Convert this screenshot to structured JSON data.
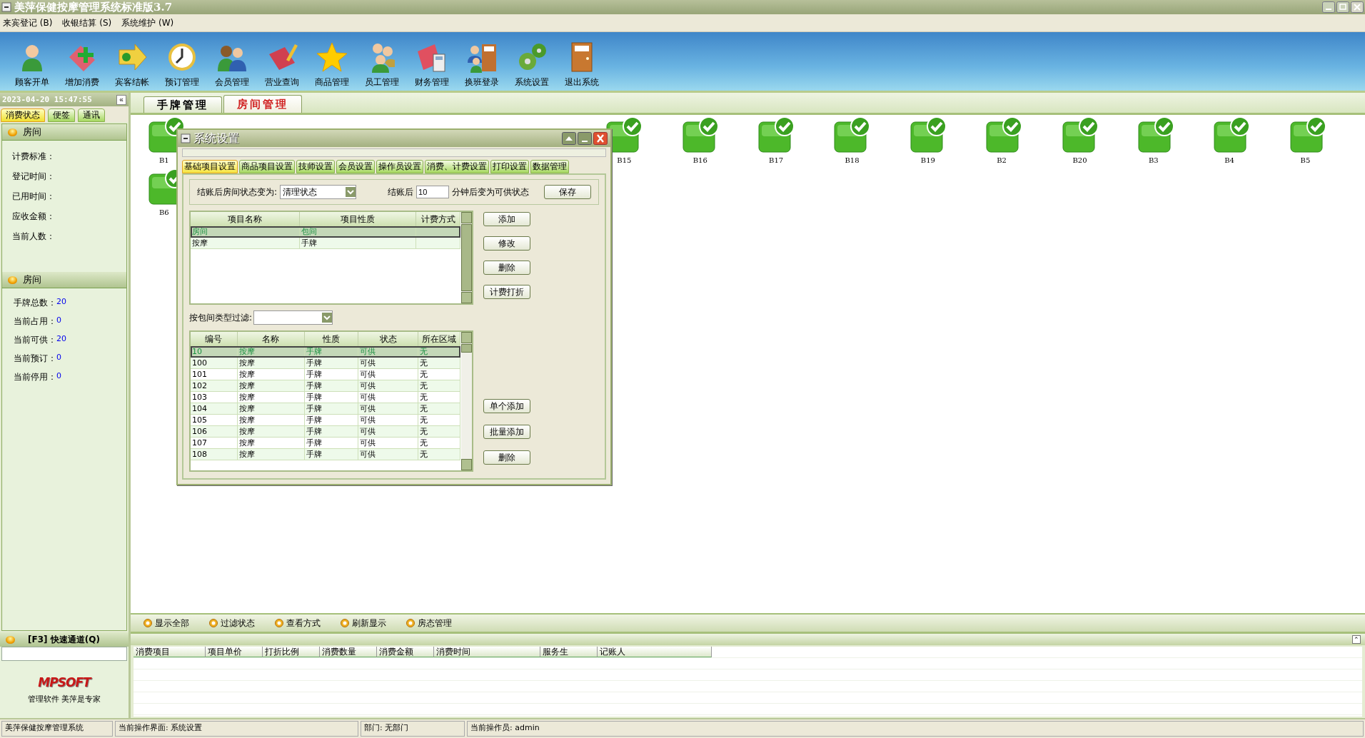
{
  "window": {
    "title": "美萍保健按摩管理系统标准版3.7"
  },
  "menu": [
    {
      "label": "来宾登记 (B)"
    },
    {
      "label": "收银结算 (S)"
    },
    {
      "label": "系统维护 (W)"
    }
  ],
  "toolbar": [
    {
      "label": "顾客开单"
    },
    {
      "label": "增加消费"
    },
    {
      "label": "宾客结帐"
    },
    {
      "label": "预订管理"
    },
    {
      "label": "会员管理"
    },
    {
      "label": "营业查询"
    },
    {
      "label": "商品管理"
    },
    {
      "label": "员工管理"
    },
    {
      "label": "财务管理"
    },
    {
      "label": "换班登录"
    },
    {
      "label": "系统设置"
    },
    {
      "label": "退出系统"
    }
  ],
  "clock": "2023-04-20 15:47:55",
  "collapse_button": "«",
  "left_tabs": [
    {
      "label": "消费状态",
      "selected": true
    },
    {
      "label": "便签",
      "selected": false
    },
    {
      "label": "通讯",
      "selected": false
    }
  ],
  "room_info": {
    "title": "房间",
    "fields": [
      {
        "label": "计费标准："
      },
      {
        "label": "登记时间："
      },
      {
        "label": "已用时间："
      },
      {
        "label": "应收金额："
      },
      {
        "label": "当前人数："
      }
    ]
  },
  "room_stats": {
    "title": "房间",
    "fields": [
      {
        "label": "手牌总数：",
        "value": "20"
      },
      {
        "label": "当前占用：",
        "value": "0"
      },
      {
        "label": "当前可供：",
        "value": "20"
      },
      {
        "label": "当前预订：",
        "value": "0"
      },
      {
        "label": "当前停用：",
        "value": "0"
      }
    ]
  },
  "quick": {
    "title": "[F3] 快速通道(Q)"
  },
  "brand": {
    "logo": "MPSOFT",
    "slogan": "管理软件 美萍是专家"
  },
  "main_tabs": [
    {
      "label": "手牌管理",
      "selected": false
    },
    {
      "label": "房间管理",
      "selected": true
    }
  ],
  "room_rows": [
    {
      "rooms": [
        {
          "name": "B1"
        },
        {
          "name": "B15"
        },
        {
          "name": "B16"
        },
        {
          "name": "B17"
        },
        {
          "name": "B18"
        },
        {
          "name": "B19"
        },
        {
          "name": "B2"
        },
        {
          "name": "B20"
        },
        {
          "name": "B3"
        },
        {
          "name": "B4"
        },
        {
          "name": "B5"
        }
      ]
    },
    {
      "rooms": [
        {
          "name": "B6"
        }
      ]
    }
  ],
  "actions": [
    {
      "label": "显示全部"
    },
    {
      "label": "过滤状态"
    },
    {
      "label": "查看方式"
    },
    {
      "label": "刷新显示"
    },
    {
      "label": "房态管理"
    }
  ],
  "log_table": {
    "expand_button": "⌃",
    "columns": [
      "消费项目",
      "项目单价",
      "打折比例",
      "消费数量",
      "消费金额",
      "消费时间",
      "服务生",
      "记账人"
    ]
  },
  "status_bar": [
    "美萍保健按摩管理系统",
    "当前操作界面: 系统设置",
    "部门: 无部门",
    "当前操作员: admin"
  ],
  "dialog": {
    "title": "系统设置",
    "tabs": [
      {
        "label": "基础项目设置",
        "selected": true
      },
      {
        "label": "商品项目设置",
        "selected": false
      },
      {
        "label": "技师设置",
        "selected": false
      },
      {
        "label": "会员设置",
        "selected": false
      },
      {
        "label": "操作员设置",
        "selected": false
      },
      {
        "label": "消费、计费设置",
        "selected": false
      },
      {
        "label": "打印设置",
        "selected": false
      },
      {
        "label": "数据管理",
        "selected": false
      }
    ],
    "checkout_label": "结账后房间状态变为:",
    "checkout_state": "清理状态",
    "after_label": "结账后",
    "minutes": "10",
    "minutes_label": "分钟后变为可供状态",
    "save": "保存",
    "items": {
      "columns": [
        "项目名称",
        "项目性质",
        "计费方式"
      ],
      "rows": [
        {
          "cells": [
            "房间",
            "包间"
          ],
          "selected": true
        },
        {
          "cells": [
            "按摩",
            "手牌"
          ],
          "selected": false
        }
      ]
    },
    "item_buttons": [
      "添加",
      "修改",
      "删除",
      "计费打折"
    ],
    "filter_label": "按包间类型过滤:",
    "rooms": {
      "columns": [
        "编号",
        "名称",
        "性质",
        "状态",
        "所在区域"
      ],
      "rows": [
        {
          "cells": [
            "10",
            "按摩",
            "手牌",
            "可供",
            "无"
          ],
          "selected": true
        },
        {
          "cells": [
            "100",
            "按摩",
            "手牌",
            "可供",
            "无"
          ],
          "selected": false
        },
        {
          "cells": [
            "101",
            "按摩",
            "手牌",
            "可供",
            "无"
          ],
          "selected": false
        },
        {
          "cells": [
            "102",
            "按摩",
            "手牌",
            "可供",
            "无"
          ],
          "selected": false
        },
        {
          "cells": [
            "103",
            "按摩",
            "手牌",
            "可供",
            "无"
          ],
          "selected": false
        },
        {
          "cells": [
            "104",
            "按摩",
            "手牌",
            "可供",
            "无"
          ],
          "selected": false
        },
        {
          "cells": [
            "105",
            "按摩",
            "手牌",
            "可供",
            "无"
          ],
          "selected": false
        },
        {
          "cells": [
            "106",
            "按摩",
            "手牌",
            "可供",
            "无"
          ],
          "selected": false
        },
        {
          "cells": [
            "107",
            "按摩",
            "手牌",
            "可供",
            "无"
          ],
          "selected": false
        },
        {
          "cells": [
            "108",
            "按摩",
            "手牌",
            "可供",
            "无"
          ],
          "selected": false
        }
      ]
    },
    "room_buttons": [
      "单个添加",
      "批量添加",
      "删除"
    ]
  }
}
